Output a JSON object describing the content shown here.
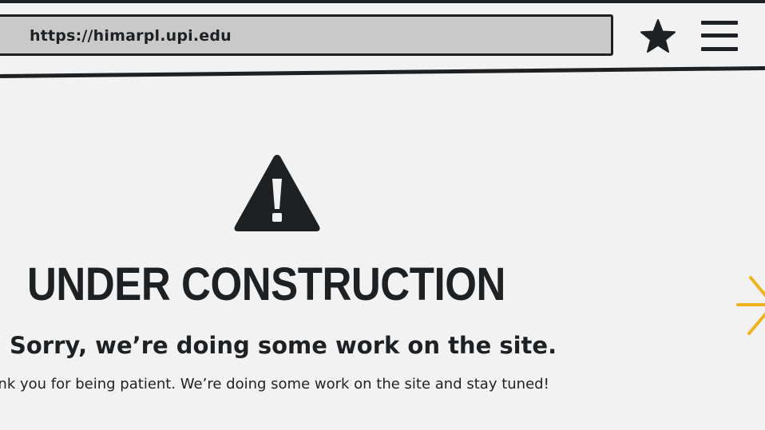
{
  "browser": {
    "url": "https://himarpl.upi.edu",
    "bookmark_icon": "star-icon",
    "menu_icon": "hamburger-menu-icon"
  },
  "main": {
    "icon": "warning-triangle-icon",
    "headline": "UNDER CONSTRUCTION",
    "subheadline": "Sorry, we’re doing some work on the site.",
    "message": "Thank you for being patient. We’re doing some work on the site and stay tuned!",
    "decoration_icon": "sparkle-icon"
  },
  "colors": {
    "ink": "#1e2124",
    "background": "#f2f2f2",
    "url_bar": "#c9c9c9",
    "accent": "#f0b21e"
  }
}
